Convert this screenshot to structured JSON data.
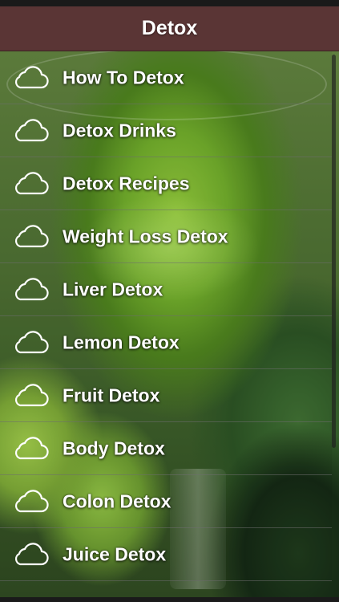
{
  "header": {
    "title": "Detox"
  },
  "menu": {
    "items": [
      {
        "label": "How To Detox",
        "icon": "cloud-icon"
      },
      {
        "label": "Detox Drinks",
        "icon": "cloud-icon"
      },
      {
        "label": "Detox Recipes",
        "icon": "cloud-icon"
      },
      {
        "label": "Weight Loss Detox",
        "icon": "cloud-icon"
      },
      {
        "label": "Liver Detox",
        "icon": "cloud-icon"
      },
      {
        "label": "Lemon Detox",
        "icon": "cloud-icon"
      },
      {
        "label": "Fruit Detox",
        "icon": "cloud-icon"
      },
      {
        "label": "Body Detox",
        "icon": "cloud-icon"
      },
      {
        "label": "Colon Detox",
        "icon": "cloud-icon"
      },
      {
        "label": "Juice Detox",
        "icon": "cloud-icon"
      }
    ]
  },
  "colors": {
    "header_bg": "#5a3535",
    "header_text": "#ffffff",
    "item_text": "#ffffff"
  }
}
